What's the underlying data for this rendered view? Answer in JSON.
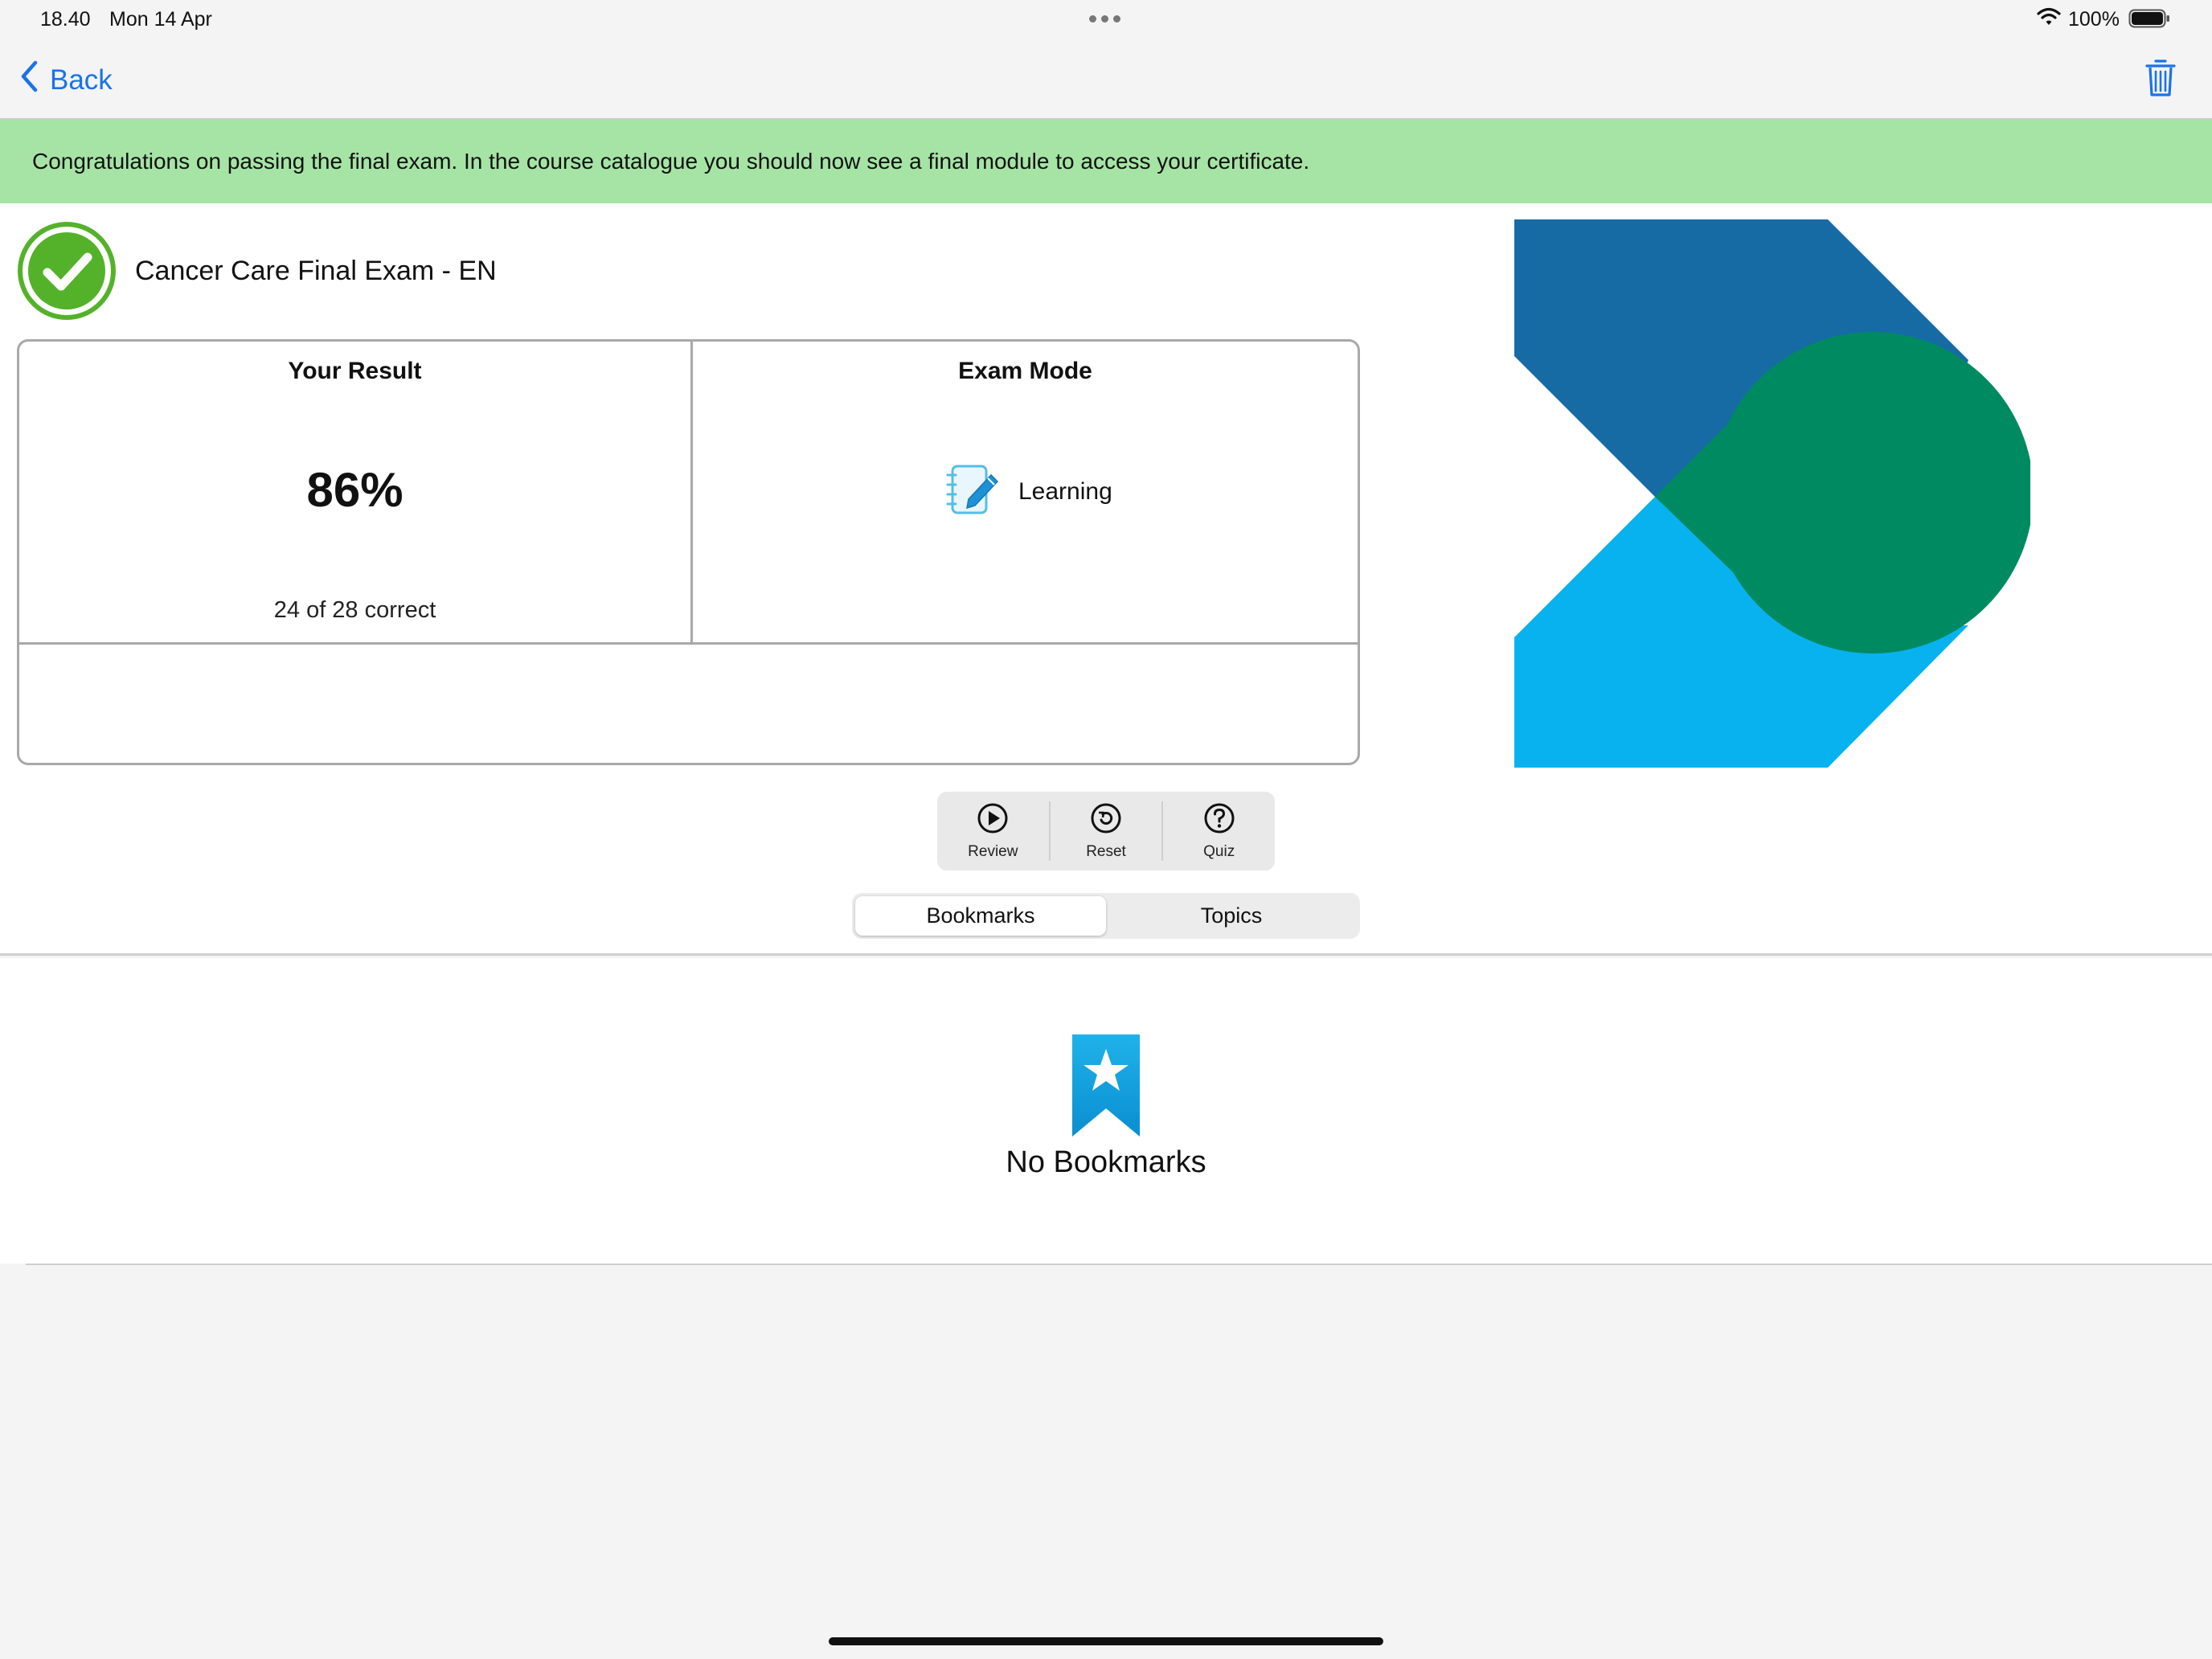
{
  "status_bar": {
    "time": "18.40",
    "date": "Mon 14 Apr",
    "battery": "100%"
  },
  "nav": {
    "back_label": "Back"
  },
  "banner": {
    "message": "Congratulations on passing the final exam. In the course catalogue you should now see a final module to access your certificate."
  },
  "exam": {
    "title": "Cancer Care Final Exam - EN",
    "result_heading": "Your Result",
    "result_percent": "86%",
    "result_detail": "24 of 28 correct",
    "mode_heading": "Exam Mode",
    "mode_value": "Learning"
  },
  "toolbar": {
    "review_label": "Review",
    "reset_label": "Reset",
    "quiz_label": "Quiz"
  },
  "segments": {
    "bookmarks_label": "Bookmarks",
    "topics_label": "Topics",
    "selected": "Bookmarks"
  },
  "empty_state": {
    "message": "No Bookmarks"
  },
  "colors": {
    "accent": "#1a73e8",
    "banner": "#a6e4a6",
    "pass_green": "#54b22a",
    "logo_dark_blue": "#166ba5",
    "logo_green": "#008a61",
    "logo_light_blue": "#08b2ee",
    "bookmark_blue": "#0aa0dc"
  },
  "icons": {
    "back": "chevron-left-icon",
    "delete": "trash-icon",
    "pass": "checkmark-circle-icon",
    "mode": "notebook-pencil-icon",
    "review": "play-circle-icon",
    "reset": "reset-circle-icon",
    "quiz": "question-circle-icon",
    "empty": "bookmark-star-icon"
  }
}
